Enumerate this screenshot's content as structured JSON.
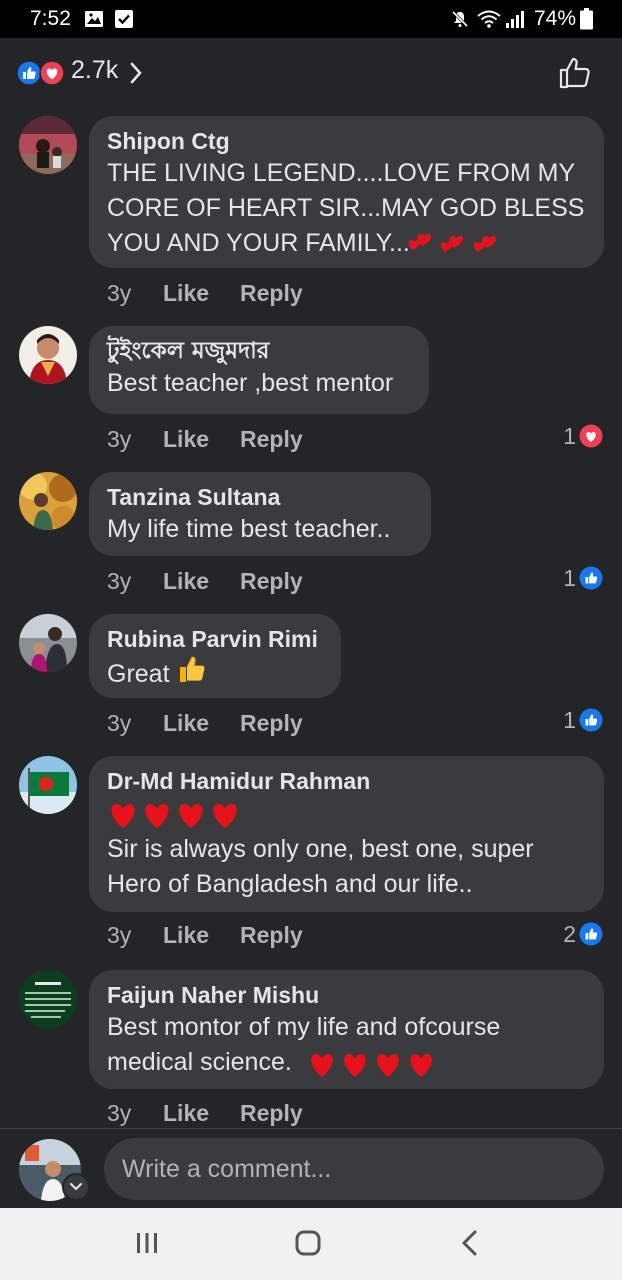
{
  "status_bar": {
    "time": "7:52",
    "battery": "74%"
  },
  "reactions": {
    "count": "2.7k"
  },
  "comments": [
    {
      "author": "Shipon Ctg",
      "text": "THE LIVING LEGEND....LOVE FROM MY\nCORE OF HEART SIR...MAY GOD BLESS\nYOU AND YOUR FAMILY...",
      "time": "3y",
      "like": "Like",
      "reply": "Reply",
      "reaction_count": ""
    },
    {
      "author": "টুইংকেল মজুমদার",
      "text": "Best teacher ,best mentor",
      "time": "3y",
      "like": "Like",
      "reply": "Reply",
      "reaction_count": "1"
    },
    {
      "author": "Tanzina Sultana",
      "text": "My life time best teacher..",
      "time": "3y",
      "like": "Like",
      "reply": "Reply",
      "reaction_count": "1"
    },
    {
      "author": "Rubina Parvin Rimi",
      "text": "Great",
      "time": "3y",
      "like": "Like",
      "reply": "Reply",
      "reaction_count": "1"
    },
    {
      "author": "Dr-Md Hamidur Rahman",
      "text": "Sir is always only one, best one, super\nHero of Bangladesh and our life..",
      "time": "3y",
      "like": "Like",
      "reply": "Reply",
      "reaction_count": "2"
    },
    {
      "author": "Faijun Naher Mishu",
      "text": "Best montor of my life and ofcourse\nmedical science.",
      "time": "3y",
      "like": "Like",
      "reply": "Reply",
      "reaction_count": ""
    }
  ],
  "compose": {
    "placeholder": "Write a comment..."
  },
  "colors": {
    "like_blue": "#1877f2",
    "love_red": "#f33e58",
    "heart_red": "#e8101b",
    "bubble": "#3a3b3c",
    "background": "#242526"
  }
}
